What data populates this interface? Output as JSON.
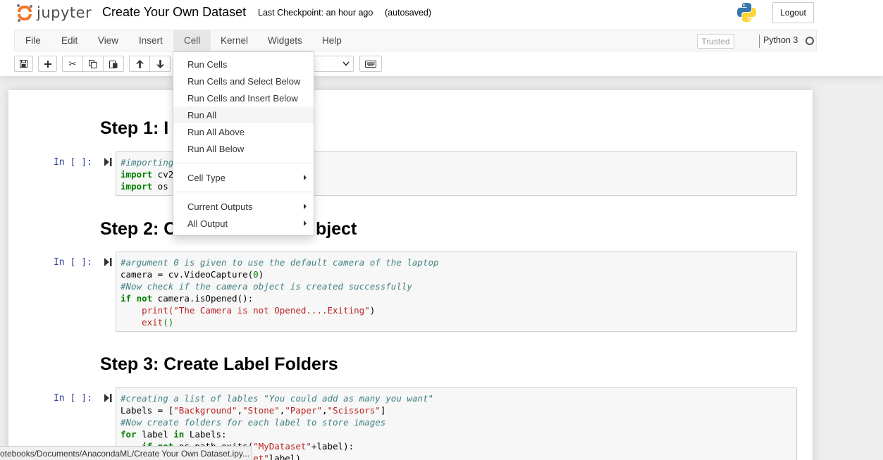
{
  "header": {
    "logo_text": "jupyter",
    "notebook_title": "Create Your Own Dataset",
    "checkpoint": "Last Checkpoint: an hour ago",
    "autosave": "(autosaved)",
    "logout_label": "Logout"
  },
  "menubar": {
    "items": [
      "File",
      "Edit",
      "View",
      "Insert",
      "Cell",
      "Kernel",
      "Widgets",
      "Help"
    ],
    "open_menu": "Cell",
    "trusted": "Trusted",
    "kernel": "Python 3"
  },
  "toolbar": {
    "icons": [
      "save-icon",
      "add-cell-icon",
      "cut-icon",
      "copy-icon",
      "paste-icon",
      "move-up-icon",
      "move-down-icon",
      "keyboard-icon"
    ]
  },
  "cell_menu": {
    "items": [
      {
        "label": "Run Cells"
      },
      {
        "label": "Run Cells and Select Below"
      },
      {
        "label": "Run Cells and Insert Below"
      },
      {
        "label": "Run All",
        "highlighted": true
      },
      {
        "label": "Run All Above"
      },
      {
        "label": "Run All Below"
      },
      {
        "label": "Cell Type",
        "submenu": true
      },
      {
        "label": "Current Outputs",
        "submenu": true
      },
      {
        "label": "All Output",
        "submenu": true
      }
    ]
  },
  "cells": {
    "heading1": "Step 1: Import Libraries",
    "heading1_visible": "Step 1: I",
    "prompt": "In [ ]:",
    "code1": [
      [
        {
          "t": "#importing",
          "c": "cm"
        }
      ],
      [
        {
          "t": "import",
          "c": "kw"
        },
        {
          "t": " cv2",
          "c": "pl"
        }
      ],
      [
        {
          "t": "import",
          "c": "kw"
        },
        {
          "t": " os",
          "c": "pl"
        }
      ]
    ],
    "heading2_visible_left": "Step 2: C",
    "heading2_visible_right": "bject",
    "code2": [
      [
        {
          "t": "#argument 0 is given to use the default camera of the laptop",
          "c": "cm"
        }
      ],
      [
        {
          "t": "camera = cv.VideoCapture(",
          "c": "pl"
        },
        {
          "t": "0",
          "c": "nm"
        },
        {
          "t": ")",
          "c": "pl"
        }
      ],
      [
        {
          "t": "#Now check if the camera object is created successfully",
          "c": "cm"
        }
      ],
      [
        {
          "t": "if",
          "c": "kw"
        },
        {
          "t": " ",
          "c": "pl"
        },
        {
          "t": "not",
          "c": "kw"
        },
        {
          "t": " camera.isOpened():",
          "c": "pl"
        }
      ],
      [
        {
          "t": "    print(",
          "c": "st"
        },
        {
          "t": "\"The Camera is not Opened....Exiting\"",
          "c": "st"
        },
        {
          "t": ")",
          "c": "pl"
        }
      ],
      [
        {
          "t": "    exit",
          "c": "st"
        },
        {
          "t": "()",
          "c": "nm"
        }
      ]
    ],
    "heading3": "Step 3: Create Label Folders",
    "code3": [
      [
        {
          "t": "#creating a list of lables \"You could add as many you want\"",
          "c": "cm"
        }
      ],
      [
        {
          "t": "Labels = [",
          "c": "pl"
        },
        {
          "t": "\"Background\"",
          "c": "st"
        },
        {
          "t": ",",
          "c": "pl"
        },
        {
          "t": "\"Stone\"",
          "c": "st"
        },
        {
          "t": ",",
          "c": "pl"
        },
        {
          "t": "\"Paper\"",
          "c": "st"
        },
        {
          "t": ",",
          "c": "pl"
        },
        {
          "t": "\"Scissors\"",
          "c": "st"
        },
        {
          "t": "]",
          "c": "pl"
        }
      ],
      [
        {
          "t": "#Now create folders for each label to store images",
          "c": "cm"
        }
      ],
      [
        {
          "t": "for",
          "c": "kw"
        },
        {
          "t": " label ",
          "c": "pl"
        },
        {
          "t": "in",
          "c": "kw"
        },
        {
          "t": " Labels:",
          "c": "pl"
        }
      ],
      [
        {
          "t": "    ",
          "c": "pl"
        },
        {
          "t": "if",
          "c": "kw"
        },
        {
          "t": " ",
          "c": "pl"
        },
        {
          "t": "not",
          "c": "kw"
        },
        {
          "t": " os.path.exits(",
          "c": "pl"
        },
        {
          "t": "\"MyDataset\"",
          "c": "st"
        },
        {
          "t": "+label):",
          "c": "pl"
        }
      ],
      [
        {
          "t": "        os.mkdir(",
          "c": "pl"
        },
        {
          "t": "\"MyDataset\"",
          "c": "st"
        },
        {
          "t": "label)",
          "c": "pl"
        }
      ]
    ]
  },
  "statusbar": {
    "url": "otebooks/Documents/AnacondaML/Create Your Own Dataset.ipy..."
  }
}
